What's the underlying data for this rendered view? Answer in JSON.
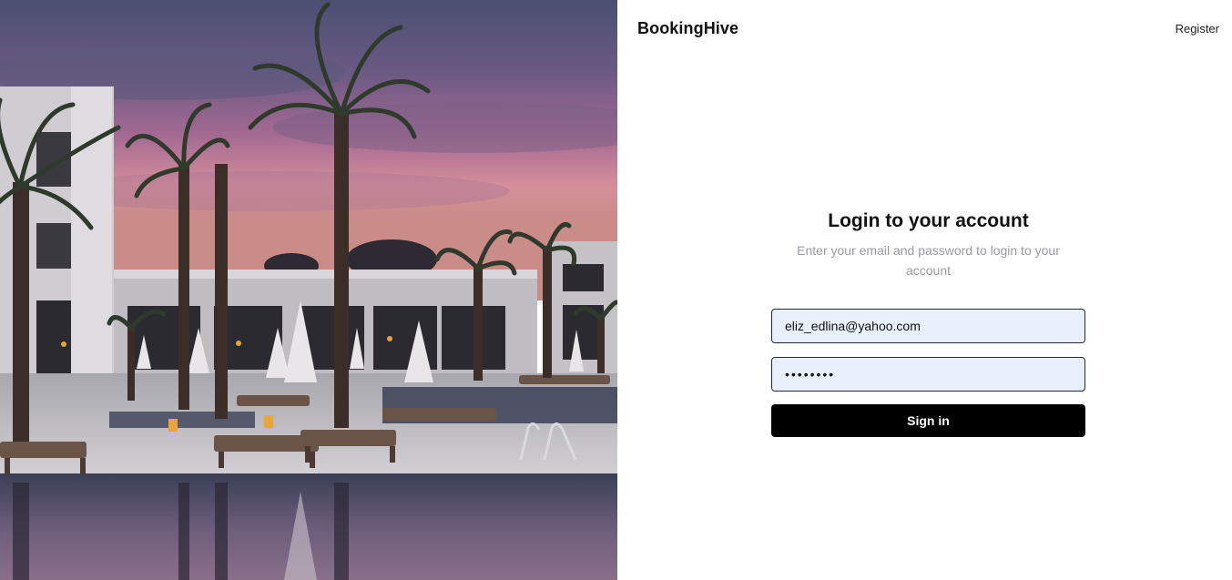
{
  "hero": {
    "alt": "Resort pool with palm trees at sunset"
  },
  "header": {
    "brand": "BookingHive",
    "register_label": "Register"
  },
  "login": {
    "title": "Login to your account",
    "subtitle": "Enter your email and password to login to your account",
    "email_value": "eliz_edlina@yahoo.com",
    "password_value": "••••••••",
    "signin_label": "Sign in"
  },
  "colors": {
    "button_bg": "#000000",
    "field_bg": "#e8f0fe",
    "subtitle": "#9a9aa3"
  }
}
